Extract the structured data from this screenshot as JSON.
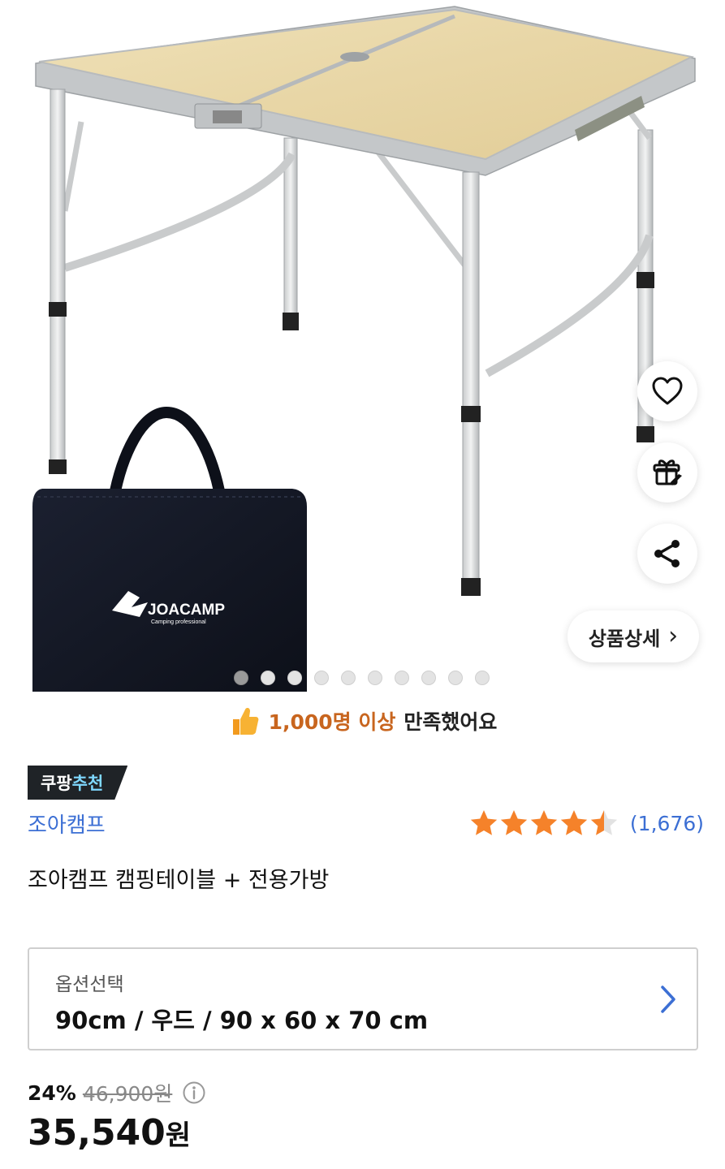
{
  "gallery": {
    "bag_logo_text": "JOACAMP",
    "bag_logo_subtext": "Camping professional",
    "slide_count": 10,
    "active_slide_index": 0,
    "detail_button_label": "상품상세",
    "detail_chevron": "›"
  },
  "satisfaction": {
    "highlight": "1,000명 이상",
    "rest": "만족했어요",
    "icon": "thumbs-up-icon"
  },
  "recommendation_badge": {
    "part1": "쿠팡",
    "part2": "추천"
  },
  "brand": "조아캠프",
  "rating": {
    "stars": 4.5,
    "count_text": "(1,676)",
    "star_color": "#f5822a"
  },
  "product_title": "조아캠프 캠핑테이블 + 전용가방",
  "option": {
    "label": "옵션선택",
    "value": "90cm / 우드 / 90 x 60 x 70 cm"
  },
  "price": {
    "discount_rate": "24%",
    "original_price": "46,900원",
    "sale_amount": "35,540",
    "sale_unit": "원"
  },
  "colors": {
    "accent_blue": "#3c6fd4",
    "highlight_orange": "#c8651e",
    "badge_bg": "#1f2327"
  }
}
